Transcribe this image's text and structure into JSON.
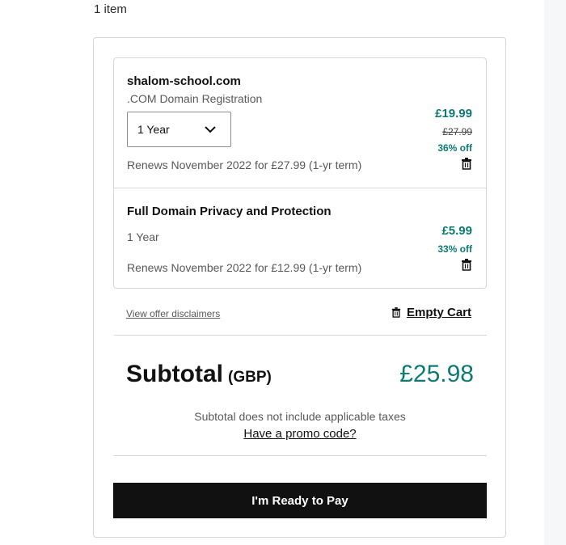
{
  "cart": {
    "item_count": "1 item",
    "items": [
      {
        "title": "shalom-school.com",
        "subtitle": ".COM Domain Registration",
        "term": "1 Year",
        "renews": "Renews November 2022 for £27.99 (1-yr term)",
        "price": "£19.99",
        "old_price": "£27.99",
        "discount": "36% off"
      },
      {
        "title": "Full Domain Privacy and Protection",
        "subtitle": "1 Year",
        "renews": "Renews November 2022 for £12.99 (1-yr term)",
        "price": "£5.99",
        "discount": "33% off"
      }
    ],
    "view_disclaimers": "View offer disclaimers",
    "empty_cart": "Empty Cart",
    "subtotal_label": "Subtotal",
    "subtotal_currency": "(GBP)",
    "subtotal_amount": "£25.98",
    "tax_note": "Subtotal does not include applicable taxes",
    "promo_link": "Have a promo code?",
    "pay_button": "I'm Ready to Pay"
  },
  "icons": {
    "term_dropdown": "chevron-down-icon",
    "remove_item": "trash-icon",
    "empty_cart": "trash-icon"
  },
  "colors": {
    "accent": "#0f7a74",
    "button_bg": "#111111",
    "border": "#d6d6d6"
  }
}
